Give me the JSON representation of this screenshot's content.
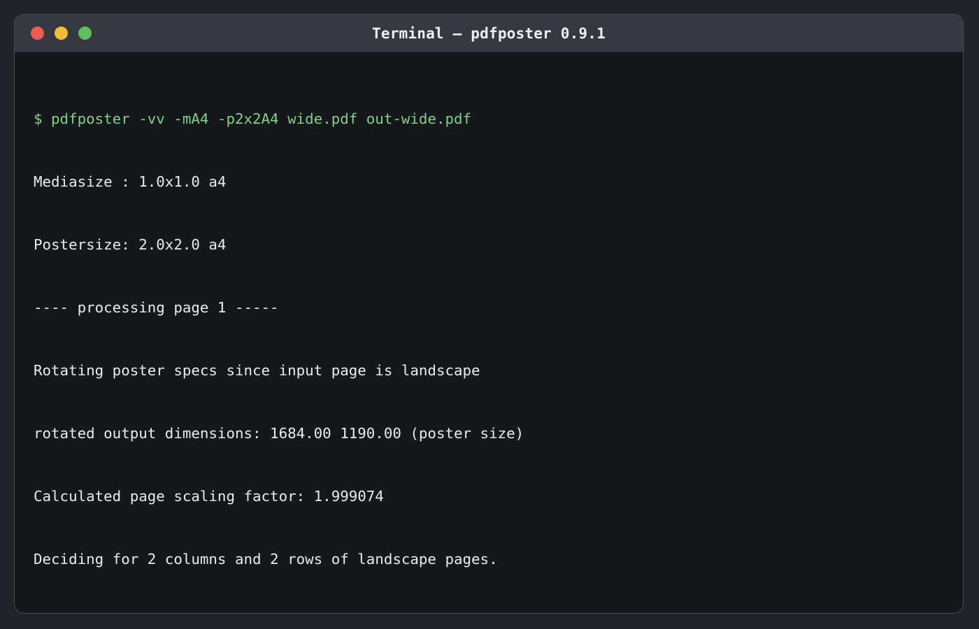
{
  "window": {
    "title": "Terminal — pdfposter 0.9.1"
  },
  "terminal": {
    "command": "$ pdfposter -vv -mA4 -p2x2A4 wide.pdf out-wide.pdf",
    "output": [
      "Mediasize : 1.0x1.0 a4",
      "Postersize: 2.0x2.0 a4",
      "---- processing page 1 -----",
      "Rotating poster specs since input page is landscape",
      "rotated output dimensions: 1684.00 1190.00 (poster size)",
      "Calculated page scaling factor: 1.999074",
      "Deciding for 2 columns and 2 rows of landscape pages."
    ]
  },
  "colors": {
    "command": "#7fd388",
    "text": "#e9ebee",
    "background": "#15171b",
    "titlebar": "#353840",
    "close": "#ee5b55",
    "minimize": "#f4bb3a",
    "maximize": "#5cc05f"
  }
}
